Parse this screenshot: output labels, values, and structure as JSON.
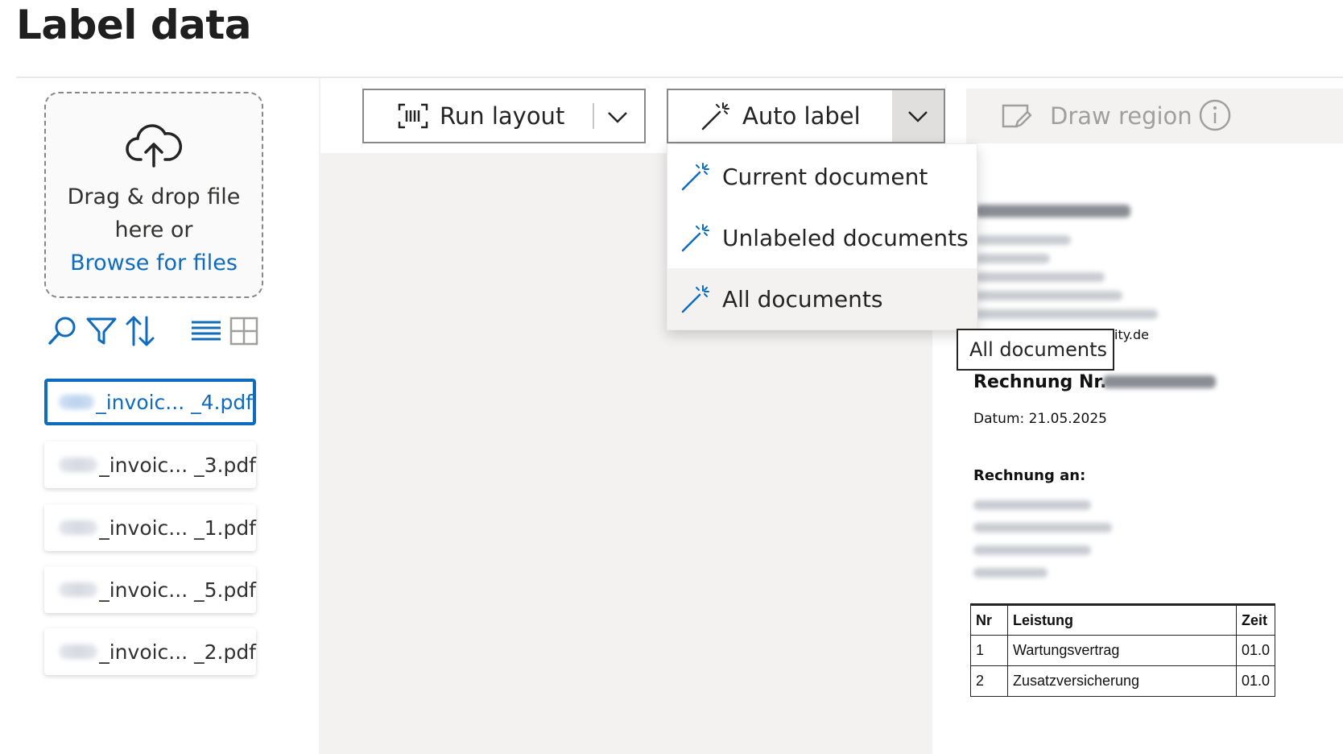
{
  "page_title": "Label data",
  "upload": {
    "line1": "Drag & drop file",
    "line2": "here or",
    "link": "Browse for files"
  },
  "file_toolbar": {
    "icons": [
      "search-icon",
      "filter-icon",
      "sort-icon",
      "list-view-icon",
      "grid-view-icon"
    ]
  },
  "files": [
    {
      "name": "_invoic...  _4.pdf",
      "selected": true
    },
    {
      "name": "_invoic...  _3.pdf",
      "selected": false
    },
    {
      "name": "_invoic...  _1.pdf",
      "selected": false
    },
    {
      "name": "_invoic...  _5.pdf",
      "selected": false
    },
    {
      "name": "_invoic...  _2.pdf",
      "selected": false
    }
  ],
  "command_bar": {
    "run_layout": "Run layout",
    "auto_label": "Auto label",
    "draw_region": "Draw region"
  },
  "auto_label_menu": {
    "items": [
      "Current document",
      "Unlabeled documents",
      "All documents"
    ],
    "hovered": "All documents"
  },
  "tooltip": "All documents",
  "document": {
    "email_tail": "ity.de",
    "invoice_label": "Rechnung Nr.",
    "date": "Datum: 21.05.2025",
    "bill_to": "Rechnung an:",
    "table": {
      "headers": [
        "Nr",
        "Leistung",
        "Zeit"
      ],
      "rows": [
        [
          "1",
          "Wartungsvertrag",
          "01.0"
        ],
        [
          "2",
          "Zusatzversicherung",
          "01.0"
        ]
      ]
    }
  },
  "colors": {
    "accent": "#0f6cbd",
    "hover_bg": "#f3f2f1"
  }
}
